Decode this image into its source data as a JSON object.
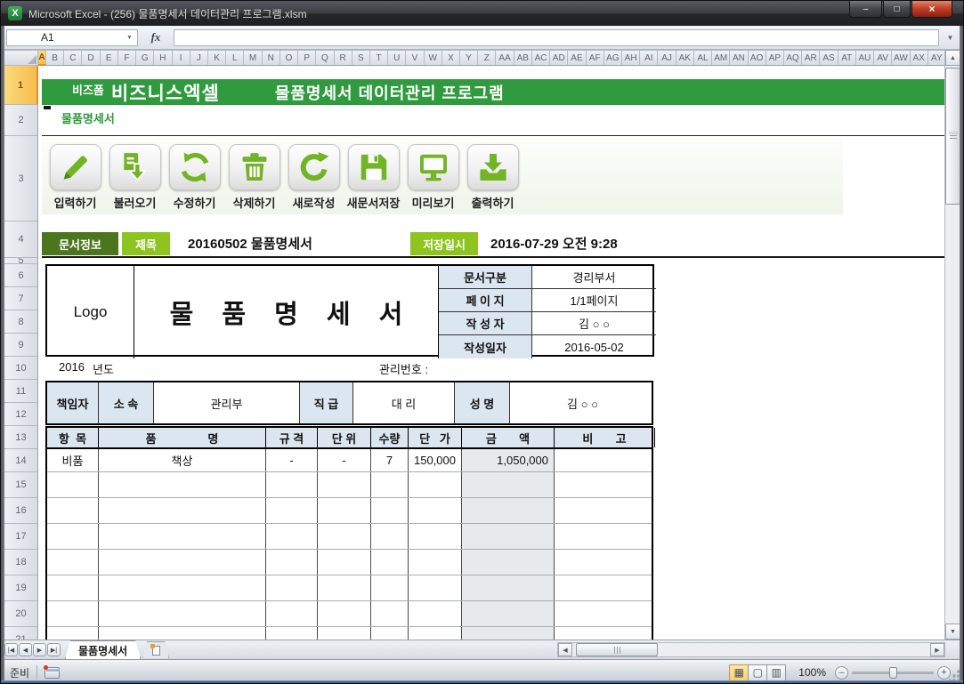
{
  "window": {
    "title": "Microsoft Excel - (256) 물품명세서 데이터관리 프로그램.xlsm"
  },
  "formula_bar": {
    "name_box": "A1",
    "fx_label": "fx",
    "formula_value": ""
  },
  "grid": {
    "column_letters": [
      "A",
      "B",
      "C",
      "D",
      "E",
      "F",
      "G",
      "H",
      "I",
      "J",
      "K",
      "L",
      "M",
      "N",
      "O",
      "P",
      "Q",
      "R",
      "S",
      "T",
      "U",
      "V",
      "W",
      "X",
      "Y",
      "Z",
      "AA",
      "AB",
      "AC",
      "AD",
      "AE",
      "AF",
      "AG",
      "AH",
      "AI",
      "AJ",
      "AK",
      "AL",
      "AM",
      "AN",
      "AO",
      "AP",
      "AQ",
      "AR",
      "AS",
      "AT",
      "AU",
      "AV",
      "AW",
      "AX",
      "AY"
    ],
    "row_numbers": [
      1,
      2,
      3,
      4,
      5,
      6,
      7,
      8,
      9,
      10,
      11,
      12,
      13,
      14,
      15,
      16,
      17,
      18,
      19,
      20,
      21
    ],
    "selected_column": "A",
    "selected_row": 1
  },
  "banner": {
    "brand_small": "비즈폼",
    "brand_large": "비즈니스엑셀",
    "title": "물품명세서 데이터관리 프로그램"
  },
  "nav_link": {
    "label": "물품명세서"
  },
  "toolbar": {
    "buttons": [
      {
        "label": "입력하기",
        "icon": "pencil-icon"
      },
      {
        "label": "불러오기",
        "icon": "load-document-icon"
      },
      {
        "label": "수정하기",
        "icon": "refresh-icon"
      },
      {
        "label": "삭제하기",
        "icon": "trash-icon"
      },
      {
        "label": "새로작성",
        "icon": "new-document-icon"
      },
      {
        "label": "새문서저장",
        "icon": "save-icon"
      },
      {
        "label": "미리보기",
        "icon": "preview-icon"
      },
      {
        "label": "출력하기",
        "icon": "print-icon"
      }
    ]
  },
  "doc_info_bar": {
    "doc_info_label": "문서정보",
    "title_label": "제목",
    "title_value": "20160502 물품명세서",
    "saved_label": "저장일시",
    "saved_value": "2016-07-29  오전 9:28"
  },
  "document": {
    "logo": "Logo",
    "title": "물 품 명 세 서",
    "info_rows": [
      {
        "label": "문서구분",
        "value": "경리부서"
      },
      {
        "label": "페 이 지",
        "value": "1/1페이지"
      },
      {
        "label": "작 성 자",
        "value": "김 ○ ○"
      },
      {
        "label": "작성일자",
        "value": "2016-05-02"
      }
    ],
    "year_value": "2016",
    "year_label": "년도",
    "mgmt_no_label": "관리번호 :",
    "manager_row": [
      {
        "label": "책임자",
        "header": true
      },
      {
        "label": "소 속",
        "header": true
      },
      {
        "label": "관리부",
        "header": false
      },
      {
        "label": "직 급",
        "header": true
      },
      {
        "label": "대 리",
        "header": false
      },
      {
        "label": "성 명",
        "header": true
      },
      {
        "label": "김 ○ ○",
        "header": false
      }
    ],
    "items_table": {
      "headers": [
        "항  목",
        "품                명",
        "규 격",
        "단 위",
        "수량",
        "단   가",
        "금       액",
        "비       고"
      ],
      "rows": [
        [
          "비품",
          "책상",
          "-",
          "-",
          "7",
          "150,000",
          "1,050,000",
          ""
        ]
      ],
      "empty_row_count": 7
    }
  },
  "sheet_bar": {
    "tabs": [
      {
        "label": "물품명세서",
        "active": true
      }
    ]
  },
  "status_bar": {
    "ready_label": "준비",
    "zoom_level": "100%"
  },
  "colors": {
    "banner_green": "#2f9a3e",
    "button_dark_green": "#4b761d",
    "button_light_green": "#8dc41e",
    "icon_green": "#72b426",
    "table_header_blue": "#dce6f1",
    "amount_column_gray": "#e7eaed",
    "selected_header_amber": "#f6bd4e"
  }
}
